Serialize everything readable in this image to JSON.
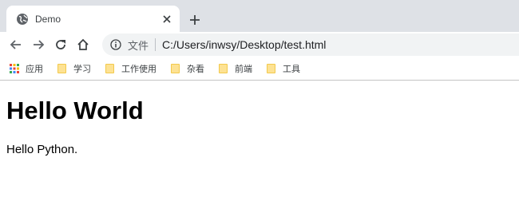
{
  "tab": {
    "title": "Demo",
    "favicon": "globe-icon",
    "close_icon": "close-icon"
  },
  "toolbar": {
    "back_icon": "back-arrow-icon",
    "forward_icon": "forward-arrow-icon",
    "reload_icon": "reload-icon",
    "home_icon": "home-icon"
  },
  "omnibox": {
    "info_icon": "info-icon",
    "scheme_label": "文件",
    "url": "C:/Users/inwsy/Desktop/test.html"
  },
  "bookmarks": [
    {
      "label": "应用",
      "icon": "apps-grid-icon"
    },
    {
      "label": "学习",
      "icon": "folder-icon"
    },
    {
      "label": "工作使用",
      "icon": "folder-icon"
    },
    {
      "label": "杂看",
      "icon": "folder-icon"
    },
    {
      "label": "前端",
      "icon": "folder-icon"
    },
    {
      "label": "工具",
      "icon": "folder-icon"
    }
  ],
  "page": {
    "heading": "Hello World",
    "paragraph": "Hello Python."
  },
  "colors": {
    "tabstrip": "#dee1e6",
    "omnibox": "#f1f3f4",
    "folder": "#fde293"
  }
}
